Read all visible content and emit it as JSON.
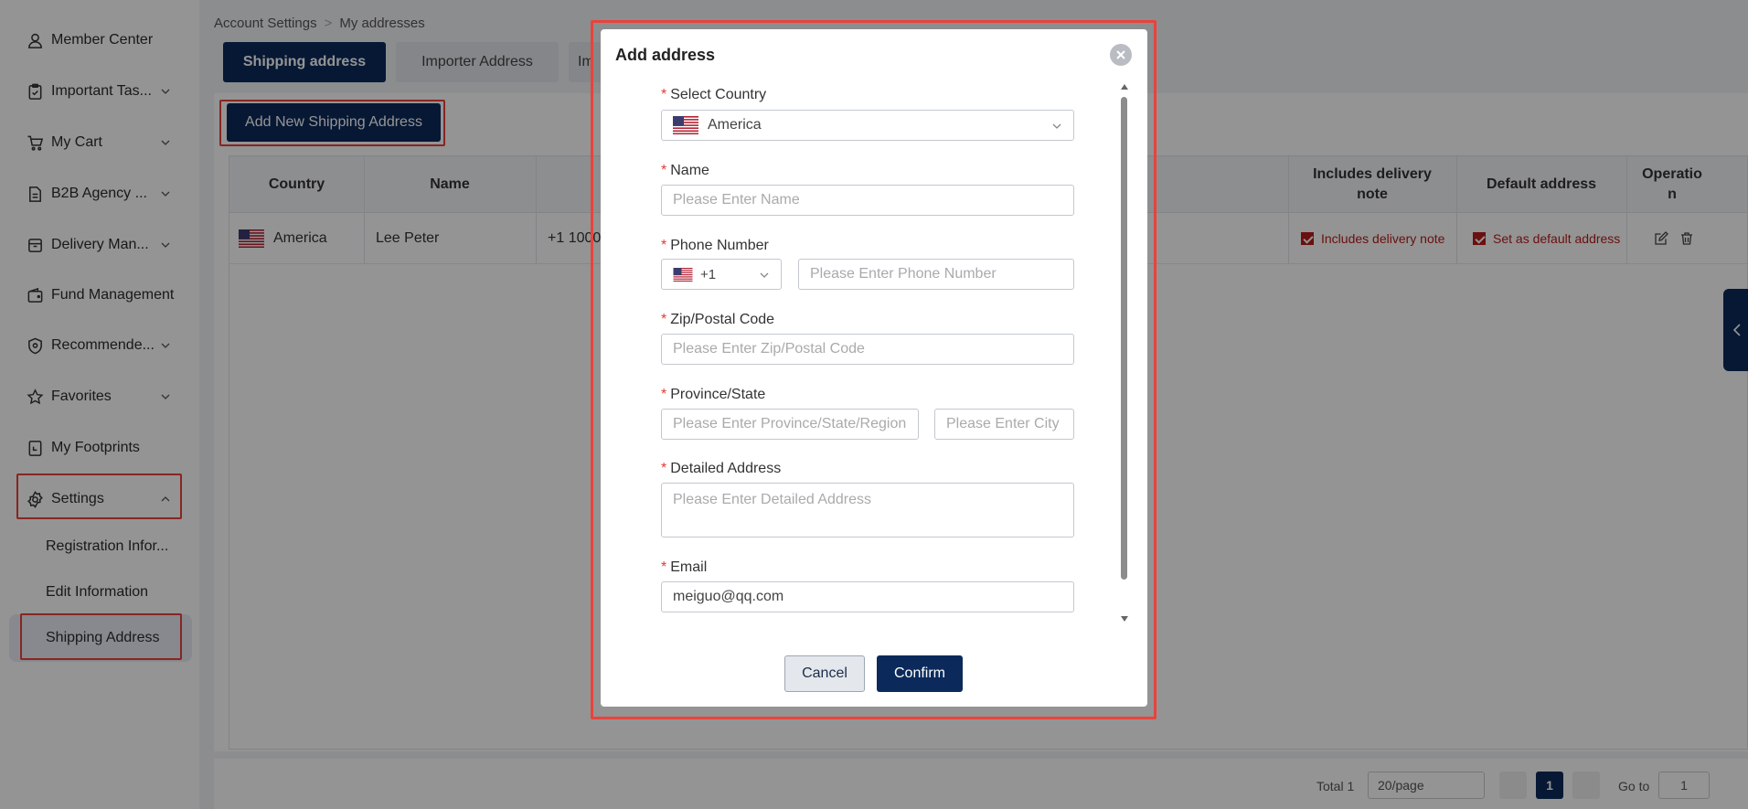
{
  "sidebar": {
    "items": [
      {
        "label": "Member Center",
        "icon": "user-icon"
      },
      {
        "label": "Important Tas...",
        "icon": "clipboard-icon"
      },
      {
        "label": "My Cart",
        "icon": "cart-icon"
      },
      {
        "label": "B2B Agency ...",
        "icon": "document-icon"
      },
      {
        "label": "Delivery Man...",
        "icon": "box-icon"
      },
      {
        "label": "Fund Management",
        "icon": "wallet-icon"
      },
      {
        "label": "Recommende...",
        "icon": "shield-icon"
      },
      {
        "label": "Favorites",
        "icon": "star-icon"
      },
      {
        "label": "My Footprints",
        "icon": "footprint-icon"
      },
      {
        "label": "Settings",
        "icon": "gear-icon"
      }
    ],
    "sub_items": [
      "Registration Infor...",
      "Edit Information",
      "Shipping Address"
    ]
  },
  "breadcrumb": {
    "parent": "Account Settings",
    "current": "My addresses"
  },
  "tabs": [
    {
      "label": "Shipping address",
      "active": true
    },
    {
      "label": "Importer Address",
      "active": false
    },
    {
      "label": "Im",
      "active": false
    }
  ],
  "add_button": "Add New Shipping Address",
  "table": {
    "headers": {
      "country": "Country",
      "name": "Name",
      "includes_note_1": "Includes delivery",
      "includes_note_2": "note",
      "default": "Default address",
      "operation_1": "Operatio",
      "operation_2": "n"
    },
    "row": {
      "country": "America",
      "name": "Lee Peter",
      "phone": "+1 1000",
      "includes_note": "Includes delivery note",
      "default": "Set as default address"
    }
  },
  "pagination": {
    "total": "Total 1",
    "page_size": "20/page",
    "current_page": "1",
    "goto_label": "Go to",
    "goto_value": "1"
  },
  "modal": {
    "title": "Add address",
    "required_mark": "*",
    "country_label": "Select Country",
    "country_value": "America",
    "name_label": "Name",
    "name_placeholder": "Please Enter Name",
    "phone_label": "Phone Number",
    "phone_code": "+1",
    "phone_placeholder": "Please Enter Phone Number",
    "zip_label": "Zip/Postal Code",
    "zip_placeholder": "Please Enter Zip/Postal Code",
    "province_label": "Province/State",
    "province_placeholder": "Please Enter Province/State/Region",
    "city_placeholder": "Please Enter City",
    "address_label": "Detailed Address",
    "address_placeholder": "Please Enter Detailed Address",
    "email_label": "Email",
    "email_value": "meiguo@qq.com",
    "cancel": "Cancel",
    "confirm": "Confirm"
  },
  "colors": {
    "accent": "#0b2a5b",
    "highlight": "#e8433c",
    "checkbox": "#b71c1c"
  }
}
